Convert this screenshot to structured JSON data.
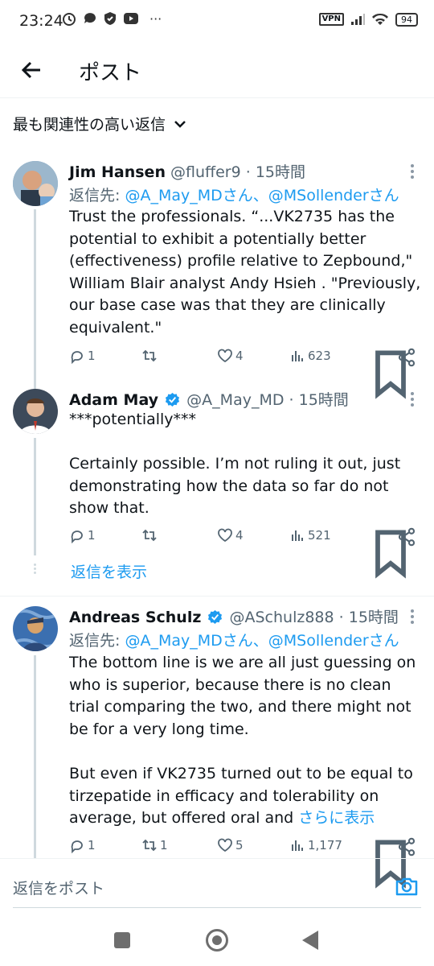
{
  "status_bar": {
    "time": "23:24",
    "battery": "94",
    "vpn": "VPN",
    "ellipsis": "···"
  },
  "header": {
    "title": "ポスト"
  },
  "sort": {
    "label": "最も関連性の高い返信"
  },
  "tweets": [
    {
      "name": "Jim Hansen",
      "handle": "@fluffer9",
      "time": "15時間",
      "verified": false,
      "reply_prefix": "返信先: ",
      "reply_to": "@A_May_MDさん、@MSollenderさん",
      "lines": [
        "Trust the professionals. “...VK2735 has the potential to exhibit a potentially better (effectiveness) profile relative to Zepbound,\" William Blair analyst Andy Hsieh . \"Previously, our base case was that they are clinically equivalent.\""
      ],
      "replies": "1",
      "reposts": "",
      "likes": "4",
      "views": "623"
    },
    {
      "name": "Adam May",
      "handle": "@A_May_MD",
      "time": "15時間",
      "verified": true,
      "lines": [
        "***potentially***",
        "",
        "Certainly possible.  I’m not ruling it out, just demonstrating how the data so far do not show that."
      ],
      "replies": "1",
      "reposts": "",
      "likes": "4",
      "views": "521",
      "show_replies": "返信を表示"
    },
    {
      "name": "Andreas Schulz",
      "handle": "@ASchulz888",
      "time": "15時間",
      "verified": true,
      "reply_prefix": "返信先: ",
      "reply_to": "@A_May_MDさん、@MSollenderさん",
      "lines": [
        "The bottom line is we are all just guessing on who is superior, because there is no clean trial comparing the two, and there might not be for a very long time.",
        "",
        "But even if VK2735 turned out to be equal to tirzepatide in efficacy and tolerability on average, but offered oral and"
      ],
      "show_more": "さらに表示",
      "replies": "1",
      "reposts": "1",
      "likes": "5",
      "views": "1,177"
    }
  ],
  "compose": {
    "placeholder": "返信をポスト"
  },
  "colors": {
    "accent": "#1d9bf0",
    "text": "#0f1419",
    "muted": "#536471",
    "verified": "#1d9bf0"
  }
}
